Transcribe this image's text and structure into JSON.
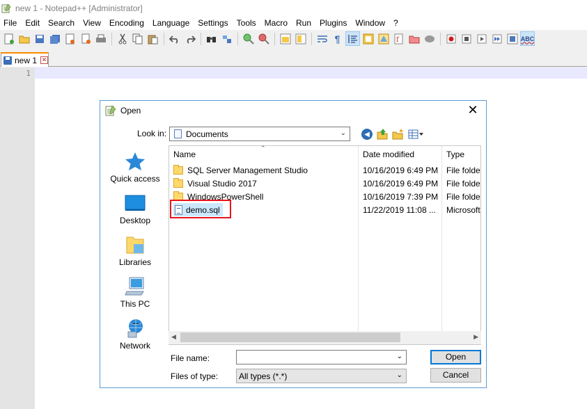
{
  "window": {
    "title": "new 1 - Notepad++ [Administrator]"
  },
  "menu": [
    "File",
    "Edit",
    "Search",
    "View",
    "Encoding",
    "Language",
    "Settings",
    "Tools",
    "Macro",
    "Run",
    "Plugins",
    "Window",
    "?"
  ],
  "toolbar": {
    "spellcheck_label": "ABC"
  },
  "tabs": [
    {
      "label": "new 1"
    }
  ],
  "editor": {
    "line_numbers": [
      "1"
    ]
  },
  "colors": {
    "tab_accent": "#fa8900",
    "dialog_border": "#5b9bd5",
    "selection_bg": "#cce8ff",
    "highlight_box": "#e8141c",
    "default_button_border": "#0078d7"
  },
  "dialog": {
    "title": "Open",
    "close_glyph": "✕",
    "look_in_label": "Look in:",
    "look_in_value": "Documents",
    "places": [
      {
        "label": "Quick access",
        "icon": "star-icon"
      },
      {
        "label": "Desktop",
        "icon": "desktop-icon"
      },
      {
        "label": "Libraries",
        "icon": "libraries-icon"
      },
      {
        "label": "This PC",
        "icon": "computer-icon"
      },
      {
        "label": "Network",
        "icon": "network-icon"
      }
    ],
    "columns": {
      "name": "Name",
      "date": "Date modified",
      "type": "Type"
    },
    "files": [
      {
        "name": "SQL Server Management Studio",
        "date": "10/16/2019 6:49 PM",
        "type": "File folder",
        "kind": "folder"
      },
      {
        "name": "Visual Studio 2017",
        "date": "10/16/2019 6:49 PM",
        "type": "File folder",
        "kind": "folder"
      },
      {
        "name": "WindowsPowerShell",
        "date": "10/16/2019 7:39 PM",
        "type": "File folder",
        "kind": "folder"
      },
      {
        "name": "demo.sql",
        "date": "11/22/2019 11:08 ...",
        "type": "Microsoft",
        "kind": "sql",
        "selected": true
      }
    ],
    "file_name_label": "File name:",
    "file_name_value": "",
    "file_type_label": "Files of type:",
    "file_type_value": "All types (*.*)",
    "open_button": "Open",
    "cancel_button": "Cancel"
  }
}
